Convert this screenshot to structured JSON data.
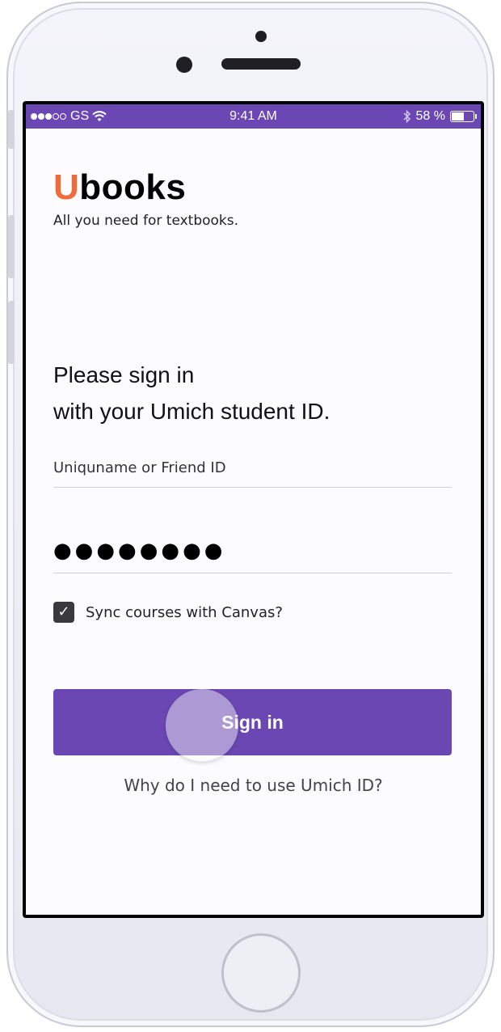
{
  "status_bar": {
    "carrier": "GS",
    "signal_bars_filled": 3,
    "signal_bars_total": 5,
    "time": "9:41 AM",
    "battery_text": "58 %",
    "battery_level": 0.58,
    "background_color": "#6a47b3"
  },
  "brand": {
    "first_letter": "U",
    "rest": "books",
    "accent_color": "#f06a3c",
    "tagline": "All you need for textbooks."
  },
  "signin": {
    "prompt_line1": "Please sign in",
    "prompt_line2": "with your Umich student ID.",
    "username_placeholder": "Uniquname or Friend ID",
    "password_mask": "●●●●●●●●",
    "sync_checked": true,
    "sync_label": "Sync courses with Canvas?",
    "button_label": "Sign in",
    "button_color": "#6a47b3",
    "help_link": "Why do I need to use Umich ID?"
  },
  "icons": {
    "wifi": "wifi-icon",
    "bluetooth": "bluetooth-icon",
    "battery": "battery-icon",
    "checkbox": "checkmark-icon"
  }
}
